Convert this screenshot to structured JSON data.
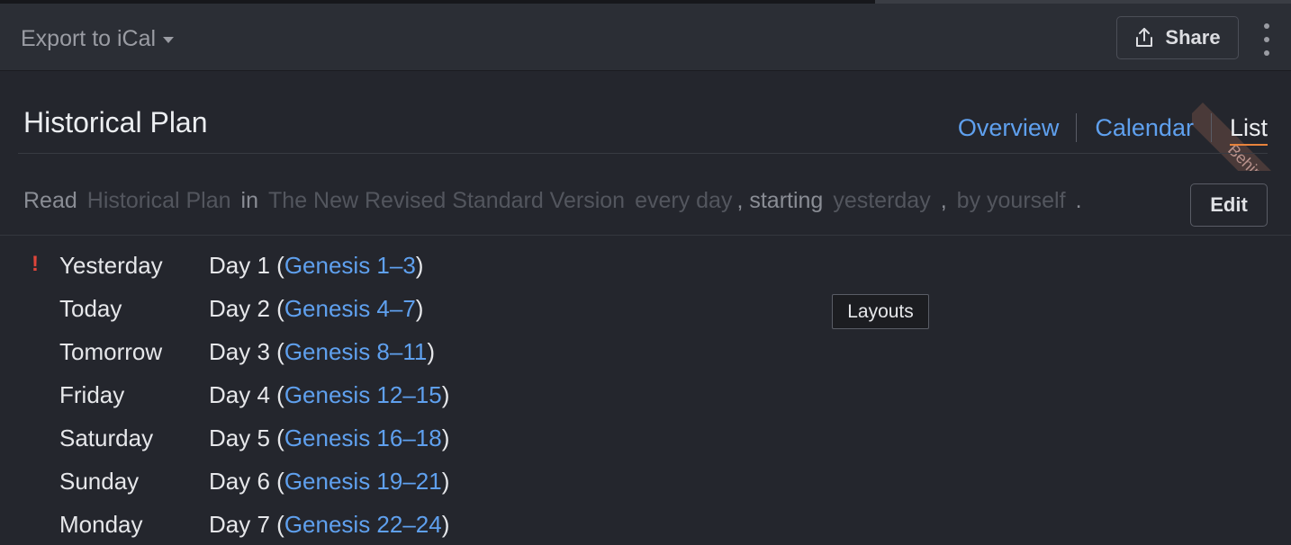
{
  "toolbar": {
    "export_label": "Export to iCal",
    "share_label": "Share"
  },
  "status_ribbon": "Behind",
  "plan": {
    "title": "Historical Plan",
    "tabs": [
      "Overview",
      "Calendar",
      "List"
    ],
    "active_tab": "List"
  },
  "sentence": {
    "read": "Read",
    "plan_name": "Historical Plan",
    "in": "in",
    "version": "The New Revised Standard Version",
    "frequency": "every day",
    "starting": ", starting",
    "start": "yesterday",
    "comma": ",",
    "who": "by yourself",
    "period": ".",
    "edit_label": "Edit"
  },
  "schedule": [
    {
      "when": "Yesterday",
      "prefix": "Day 1 (",
      "passage": "Genesis 1–3",
      "suffix": ")",
      "alert": "!"
    },
    {
      "when": "Today",
      "prefix": "Day 2 (",
      "passage": "Genesis 4–7",
      "suffix": ")",
      "alert": ""
    },
    {
      "when": "Tomorrow",
      "prefix": "Day 3 (",
      "passage": "Genesis 8–11",
      "suffix": ")",
      "alert": ""
    },
    {
      "when": "Friday",
      "prefix": "Day 4 (",
      "passage": "Genesis 12–15",
      "suffix": ")",
      "alert": ""
    },
    {
      "when": "Saturday",
      "prefix": "Day 5 (",
      "passage": "Genesis 16–18",
      "suffix": ")",
      "alert": ""
    },
    {
      "when": "Sunday",
      "prefix": "Day 6 (",
      "passage": "Genesis 19–21",
      "suffix": ")",
      "alert": ""
    },
    {
      "when": "Monday",
      "prefix": "Day 7 (",
      "passage": "Genesis 22–24",
      "suffix": ")",
      "alert": ""
    }
  ],
  "tooltip": "Layouts",
  "icons": {
    "export_caret": "caret-down-icon",
    "share": "share-upload-icon",
    "more": "kebab-menu-icon",
    "alert": "exclamation-icon"
  },
  "colors": {
    "background": "#24262d",
    "toolbar": "#2b2e35",
    "link": "#5fa0ee",
    "active_underline": "#e8833c",
    "alert": "#e0453a",
    "ribbon": "#4a3a39"
  }
}
